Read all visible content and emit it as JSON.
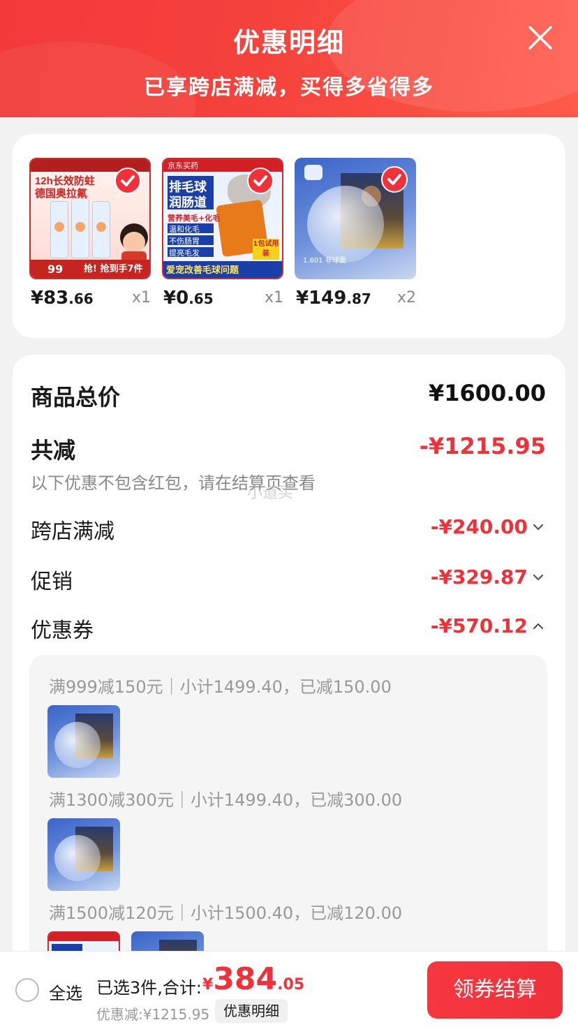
{
  "header": {
    "title": "优惠明细",
    "subtitle": "已享跨店满减，买得多省得多"
  },
  "products": [
    {
      "price_int": "¥83",
      "price_dec": ".66",
      "qty": "x1",
      "checked": true
    },
    {
      "price_int": "¥0",
      "price_dec": ".65",
      "qty": "x1",
      "checked": true
    },
    {
      "price_int": "¥149",
      "price_dec": ".87",
      "qty": "x2",
      "checked": true
    }
  ],
  "product_images": {
    "p1": {
      "line1": "12h长效防蛀",
      "line2": "德国奥拉氟",
      "bottom": "抢! 抢到手7件",
      "price": "99"
    },
    "p2": {
      "brand": "京东买药",
      "line1": "排毛球",
      "line2": "润肠道",
      "tags": [
        "营养美毛+化毛",
        "温和化毛",
        "不伤肠胃",
        "提亮毛发"
      ],
      "bottom": "爱宠改善毛球问题",
      "pack": "1包试用装"
    },
    "p3": {
      "label": "1.601 非球面"
    }
  },
  "summary": {
    "total_label": "商品总价",
    "total_value": "¥1600.00",
    "reduce_label": "共减",
    "reduce_value": "-¥1215.95",
    "note": "以下优惠不包含红包，请在结算页查看",
    "watermark": "小道买",
    "rows": [
      {
        "label": "跨店满减",
        "value": "-¥240.00",
        "expanded": false
      },
      {
        "label": "促销",
        "value": "-¥329.87",
        "expanded": false
      },
      {
        "label": "优惠券",
        "value": "-¥570.12",
        "expanded": true
      }
    ]
  },
  "coupons": [
    "满999减150元｜小计1499.40，已减150.00",
    "满1300减300元｜小计1499.40，已减300.00",
    "满1500减120元｜小计1500.40，已减120.00"
  ],
  "bottom": {
    "select_all": "全选",
    "selected_text": "已选3件,合计:",
    "total_cur": "¥",
    "total_int": "384",
    "total_dec": ".05",
    "saved_text": "优惠减:¥1215.95",
    "detail_link": "优惠明细",
    "checkout": "领券结算"
  },
  "colors": {
    "accent": "#f0313a",
    "header_bg": "#f23a3a"
  }
}
